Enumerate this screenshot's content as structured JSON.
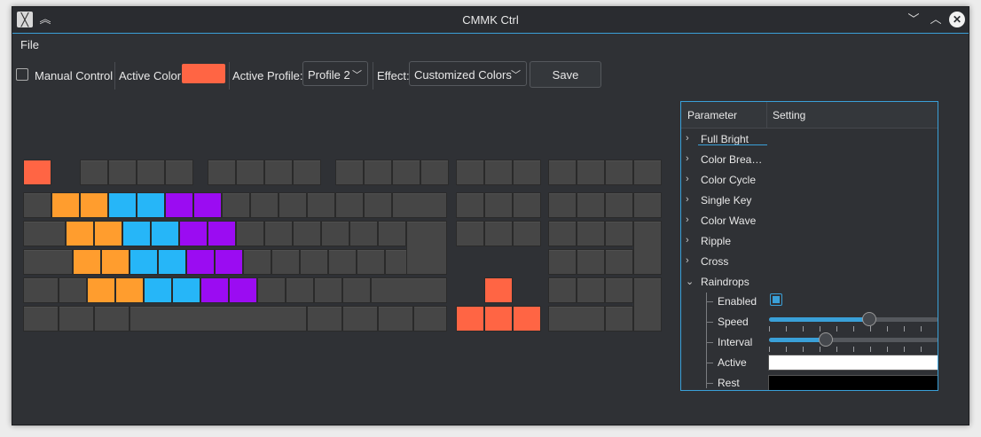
{
  "window": {
    "title": "CMMK Ctrl"
  },
  "menu": {
    "file": "File"
  },
  "toolbar": {
    "manual_control_label": "Manual Control",
    "manual_control_checked": false,
    "active_color_label": "Active Color:",
    "active_color": "#ff6544",
    "active_profile_label": "Active Profile:",
    "profile_value": "Profile 2",
    "effect_label": "Effect:",
    "effect_value": "Customized Colors",
    "save_label": "Save"
  },
  "colors": {
    "accent": "#3aa0d8",
    "key_default": "#464646",
    "key_orange_red": "#ff6544",
    "key_orange": "#ff9d2e",
    "key_blue": "#26b6f8",
    "key_purple": "#9b0cf2"
  },
  "panel": {
    "header_parameter": "Parameter",
    "header_setting": "Setting",
    "effects": [
      {
        "label": "Full Bright",
        "expanded": false
      },
      {
        "label": "Color Brea…",
        "expanded": false
      },
      {
        "label": "Color Cycle",
        "expanded": false
      },
      {
        "label": "Single Key",
        "expanded": false
      },
      {
        "label": "Color Wave",
        "expanded": false
      },
      {
        "label": "Ripple",
        "expanded": false
      },
      {
        "label": "Cross",
        "expanded": false
      },
      {
        "label": "Raindrops",
        "expanded": true
      }
    ],
    "raindrops": {
      "enabled_label": "Enabled",
      "enabled": true,
      "speed_label": "Speed",
      "speed_fraction": 0.6,
      "interval_label": "Interval",
      "interval_fraction": 0.32,
      "active_label": "Active",
      "active_color": "#ffffff",
      "rest_label": "Rest",
      "rest_color": "#000000"
    }
  }
}
